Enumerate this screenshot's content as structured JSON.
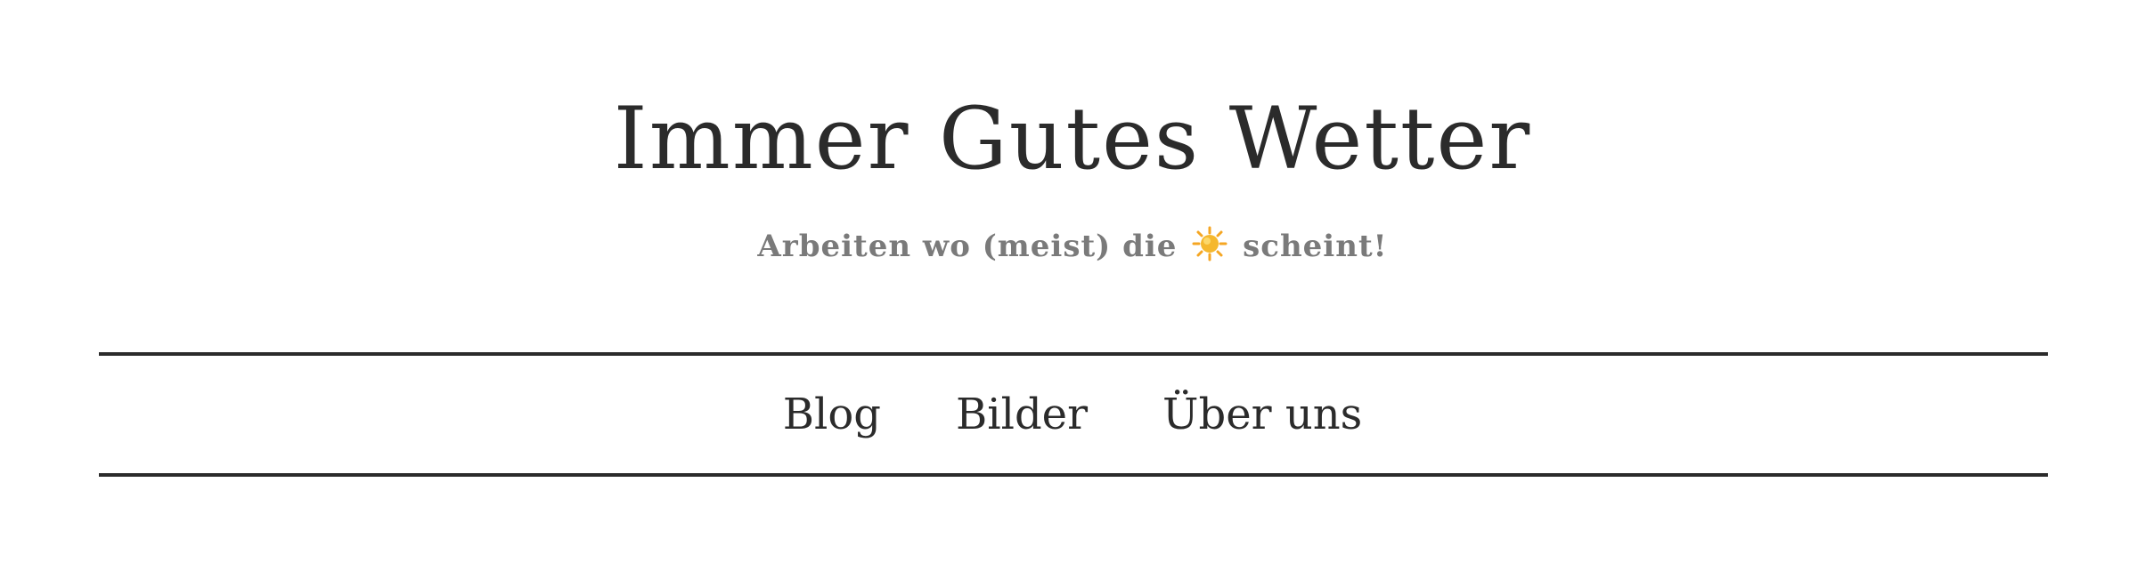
{
  "site": {
    "title": "Immer Gutes Wetter",
    "tagline_before": "Arbeiten wo (meist) die",
    "tagline_icon": "sun-icon",
    "tagline_after": "scheint!"
  },
  "nav": {
    "items": [
      {
        "label": "Blog"
      },
      {
        "label": "Bilder"
      },
      {
        "label": "Über uns"
      }
    ]
  },
  "colors": {
    "text": "#2b2b2b",
    "tagline": "#7a7a7a",
    "sun": "#f5b82e",
    "background": "#ffffff"
  }
}
